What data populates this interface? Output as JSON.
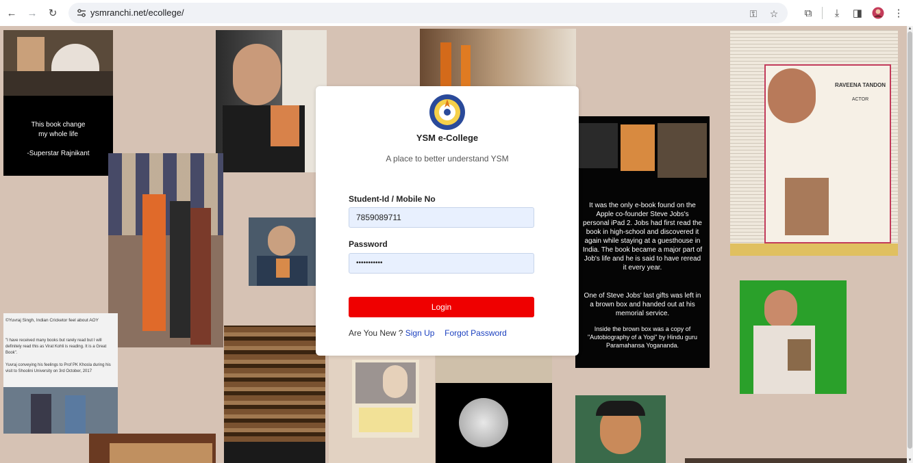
{
  "browser": {
    "url": "ysmranchi.net/ecollege/",
    "icons": [
      "back-icon",
      "forward-icon",
      "reload-icon",
      "site-info-icon",
      "password-key-icon",
      "bookmark-star-icon",
      "extensions-icon",
      "downloads-icon",
      "side-panel-icon",
      "profile-avatar",
      "more-menu-icon"
    ]
  },
  "collage": {
    "rajnikant_caption_1": "This book change",
    "rajnikant_caption_2": "my whole life",
    "rajnikant_caption_3": "-Superstar Rajnikant",
    "yuvraj_title": "©Yuvraj Singh, Indian Cricketor feel about AOY",
    "yuvraj_quote": "\"I have received many books but rarely read but I will definitely read this as Virat Kohli is reading. It is a Great Book\".",
    "yuvraj_note": "Yuvraj conveying his feelings to Prof PK Khosla during his visit to Shoolini University on 3rd October, 2017",
    "jobs_p1": "It was the only e-book found on the Apple co-founder Steve Jobs's personal iPad 2. Jobs had first read the book in high-school and discovered it again while staying at a guesthouse in India. The book became a major part of Job's life and he is said to have reread it every year.",
    "jobs_p2": "One of Steve Jobs' last gifts was left in a brown box and handed out at his memorial service.",
    "jobs_p3": "Inside the brown box was a copy of \"Autobiography of a Yogi\" by Hindu guru Paramahansa Yogananda.",
    "raveena_name": "RAVEENA TANDON",
    "raveena_role": "ACTOR"
  },
  "login": {
    "brand": "YSM e-College",
    "tagline": "A place to better understand YSM",
    "student_label": "Student-Id / Mobile No",
    "student_value": "7859089711",
    "password_label": "Password",
    "password_mask": "•••••••••••",
    "login_button": "Login",
    "new_prompt": "Are You New ?",
    "signup_link": "Sign Up",
    "forgot_link": "Forgot Password"
  },
  "colors": {
    "page_bg": "#d6c2b4",
    "login_red": "#ef0000",
    "link_blue": "#1a3fbf",
    "input_bg": "#e8f0fe"
  }
}
